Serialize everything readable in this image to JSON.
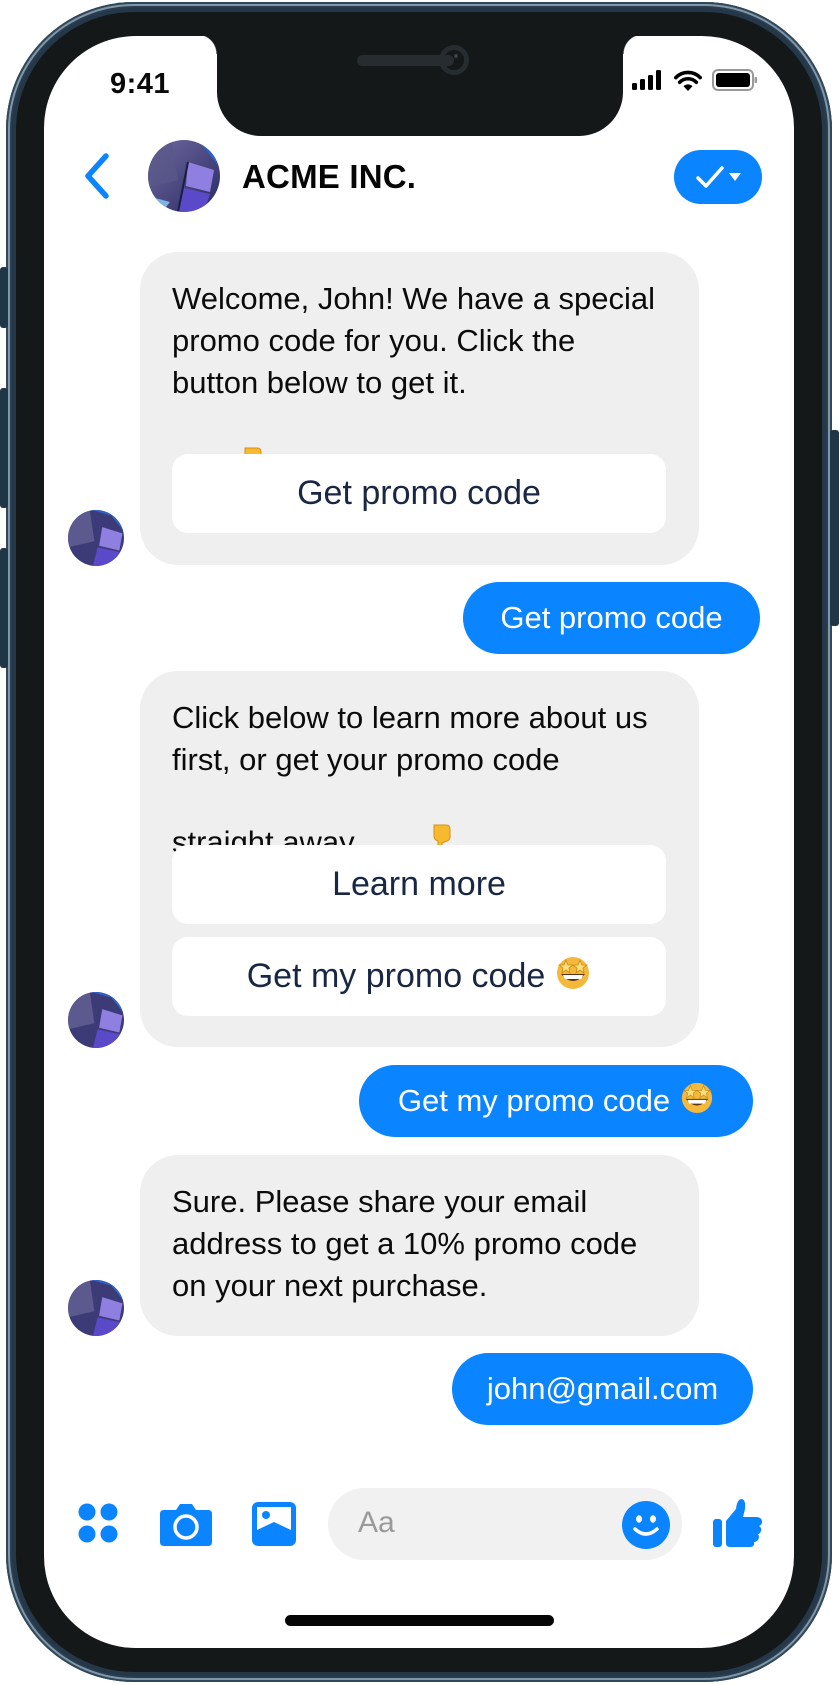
{
  "status_bar": {
    "time": "9:41"
  },
  "header": {
    "title": "ACME INC.",
    "colors": {
      "accent": "#0a84ff"
    }
  },
  "messages": [
    {
      "from": "bot",
      "text": "Welcome, John! We have a special promo code for you. Click the button below to get it.",
      "emoji": "pointing-down",
      "buttons": [
        {
          "label": "Get promo code"
        }
      ]
    },
    {
      "from": "user",
      "text": "Get promo code"
    },
    {
      "from": "bot",
      "text": "Click below to learn more about us first, or get your promo code straight away.",
      "emoji": "pointing-down",
      "buttons": [
        {
          "label": "Learn more"
        },
        {
          "label": "Get my promo code",
          "emoji": "star-struck"
        }
      ]
    },
    {
      "from": "user",
      "text": "Get my promo code",
      "emoji": "star-struck"
    },
    {
      "from": "bot",
      "text": "Sure. Please share your email address to get a 10% promo code on your next purchase."
    },
    {
      "from": "user",
      "text": "john@gmail.com"
    }
  ],
  "composer": {
    "placeholder": "Aa",
    "icons": [
      "apps-icon",
      "camera-icon",
      "gallery-icon",
      "emoji-icon",
      "thumbs-up-icon"
    ]
  },
  "colors": {
    "bubble_incoming": "#efefef",
    "bubble_outgoing": "#0a84ff",
    "quick_reply_text": "#1a2744"
  }
}
